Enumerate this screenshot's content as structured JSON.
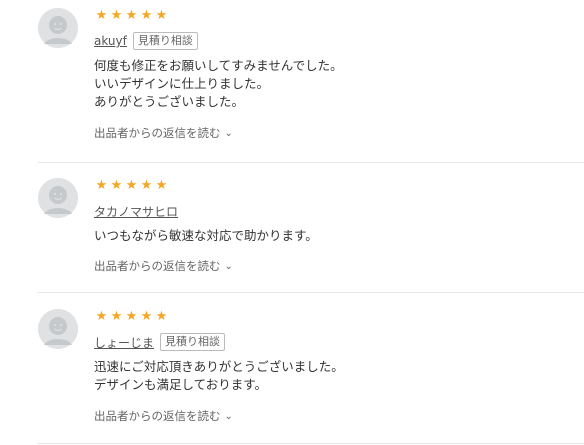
{
  "reviews": [
    {
      "stars": "★★★★★",
      "username": "akuyf",
      "badge": "見積り相談",
      "lines": [
        "何度も修正をお願いしてすみませんでした。",
        "いいデザインに仕上りました。",
        "ありがとうございました。"
      ],
      "reply_label": "出品者からの返信を読む"
    },
    {
      "stars": "★★★★★",
      "username": "タカノマサヒロ",
      "badge": "",
      "lines": [
        "いつもながら敏速な対応で助かります。"
      ],
      "reply_label": "出品者からの返信を読む"
    },
    {
      "stars": "★★★★★",
      "username": "しょーじま",
      "badge": "見積り相談",
      "lines": [
        "迅速にご対応頂きありがとうございました。",
        "デザインも満足しております。"
      ],
      "reply_label": "出品者からの返信を読む"
    }
  ],
  "icons": {
    "avatar": "default-user-avatar-icon",
    "star": "star-icon",
    "chevron": "chevron-down-icon"
  },
  "colors": {
    "star": "#f5a623",
    "avatar_bg": "#dfe1e3",
    "text": "#333333",
    "muted": "#666666",
    "divider": "#e6e6e6"
  }
}
